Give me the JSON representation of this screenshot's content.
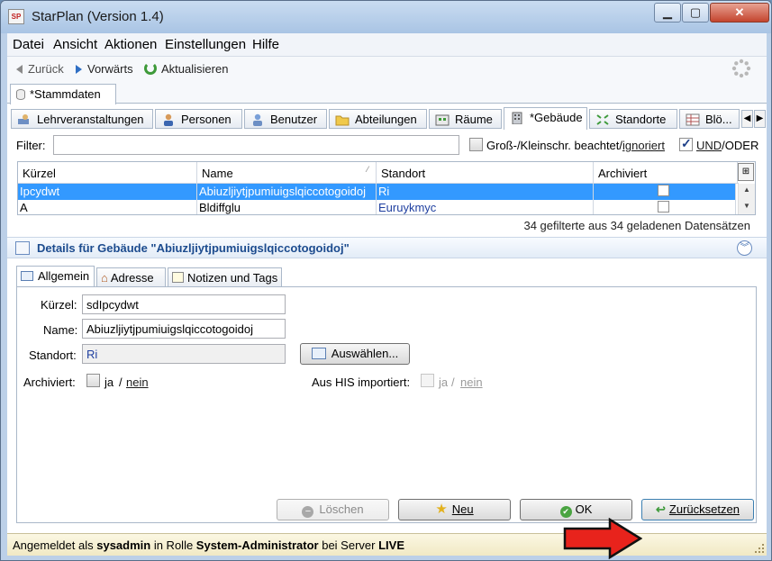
{
  "window": {
    "title": "StarPlan (Version 1.4)",
    "app_icon_text": "SP"
  },
  "menu": [
    {
      "label": "Datei"
    },
    {
      "label": "Ansicht"
    },
    {
      "label": "Aktionen"
    },
    {
      "label": "Einstellungen"
    },
    {
      "label": "Hilfe"
    }
  ],
  "nav": {
    "back": "Zurück",
    "forward": "Vorwärts",
    "refresh": "Aktualisieren"
  },
  "doc_tab": {
    "label": "*Stammdaten"
  },
  "main_tabs": [
    {
      "label": "Lehrveranstaltungen",
      "icon": "course-icon"
    },
    {
      "label": "Personen",
      "icon": "person-icon"
    },
    {
      "label": "Benutzer",
      "icon": "user-icon"
    },
    {
      "label": "Abteilungen",
      "icon": "folder-icon"
    },
    {
      "label": "Räume",
      "icon": "room-icon"
    },
    {
      "label": "*Gebäude",
      "icon": "building-icon",
      "active": true
    },
    {
      "label": "Standorte",
      "icon": "location-icon"
    },
    {
      "label": "Blö...",
      "icon": "block-icon"
    }
  ],
  "filter": {
    "label": "Filter:",
    "value": "",
    "case_label": "Groß-/Kleinschr. beachtet/",
    "case_link": "ignoriert",
    "logic_checked": true,
    "logic_and": "UND",
    "logic_or": "/ODER"
  },
  "table": {
    "columns": [
      "Kürzel",
      "Name",
      "Standort",
      "Archiviert"
    ],
    "rows": [
      {
        "kuerzel": "Ipcydwt",
        "name": "Abiuzljiytjpumiuigslqiccotogoidoj",
        "standort": "Ri",
        "archiviert": false,
        "selected": true
      },
      {
        "kuerzel": "A",
        "name": "Bldiffglu",
        "standort": "Euruykmyc",
        "archiviert": false,
        "selected": false
      }
    ],
    "status": "34 gefilterte aus 34 geladenen Datensätzen"
  },
  "details": {
    "title": "Details für Gebäude \"Abiuzljiytjpumiuigslqiccotogoidoj\"",
    "tabs": [
      {
        "label": "Allgemein",
        "active": true
      },
      {
        "label": "Adresse"
      },
      {
        "label": "Notizen und Tags"
      }
    ],
    "fields": {
      "kuerzel_label": "Kürzel:",
      "kuerzel_value": "sdIpcydwt",
      "name_label": "Name:",
      "name_value": "Abiuzljiytjpumiuigslqiccotogoidoj",
      "standort_label": "Standort:",
      "standort_value": "Ri",
      "choose_button": "Auswählen...",
      "archiviert_label": "Archiviert:",
      "archiviert_ja": "ja",
      "archiviert_sep": "/",
      "archiviert_nein": "nein",
      "his_label": "Aus HIS importiert:",
      "his_ja": "ja",
      "his_sep": "/",
      "his_nein": "nein"
    }
  },
  "buttons": {
    "delete": "Löschen",
    "new": "Neu",
    "save": "OK",
    "reset": "Zurücksetzen"
  },
  "statusbar": {
    "prefix": "Angemeldet als ",
    "user": "sysadmin",
    "mid": " in Rolle ",
    "role": "System-Administrator",
    "mid2": " bei Server ",
    "server": "LIVE"
  },
  "colors": {
    "selection": "#3399ff",
    "annotation_arrow": "#e8231c",
    "link": "#2040a0"
  }
}
